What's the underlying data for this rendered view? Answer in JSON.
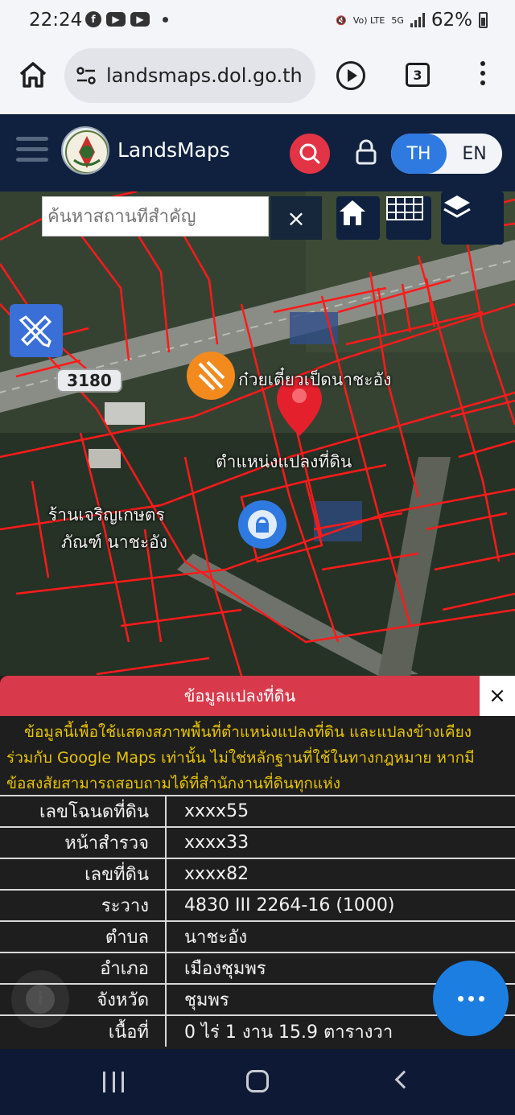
{
  "status_bar": {
    "time": "22:24",
    "app_icons": [
      "facebook-icon",
      "youtube-icon",
      "youtube-icon"
    ],
    "network": "5G",
    "volte": "Vo) LTE",
    "battery": "62%"
  },
  "browser": {
    "url": "landsmaps.dol.go.th",
    "tab_count": "3"
  },
  "app": {
    "title": "LandsMaps",
    "lang_th": "TH",
    "lang_en": "EN",
    "active_lang": "TH"
  },
  "map": {
    "search_placeholder": "ค้นหาสถานที่สำคัญ",
    "clear_label": "×",
    "road_number": "3180",
    "labels": {
      "poi_top": "ก๋วยเตี๋ยวเป็ดนาชะอัง",
      "parcel_position": "ตำแหน่งแปลงที่ดิน",
      "shop_line1": "ร้านเจริญเกษตร",
      "shop_line2": "ภัณฑ์ นาชะอัง"
    }
  },
  "panel": {
    "title": "ข้อมูลแปลงที่ดิน",
    "close_label": "×",
    "note_lines": [
      "ข้อมูลนี้เพื่อใช้แสดงสภาพพื้นที่ตำแหน่งแปลงที่ดิน และแปลงข้างเคียง",
      "ร่วมกับ Google Maps เท่านั้น ไม่ใช่หลักฐานที่ใช้ในทางกฎหมาย หากมี",
      "ข้อสงสัยสามารถสอบถามได้ที่สำนักงานที่ดินทุกแห่ง"
    ],
    "rows": [
      {
        "label": "เลขโฉนดที่ดิน",
        "value": "xxxx55"
      },
      {
        "label": "หน้าสำรวจ",
        "value": "xxxx33"
      },
      {
        "label": "เลขที่ดิน",
        "value": "xxxx82"
      },
      {
        "label": "ระวาง",
        "value": "4830 III 2264-16 (1000)"
      },
      {
        "label": "ตำบล",
        "value": "นาชะอัง"
      },
      {
        "label": "อำเภอ",
        "value": "เมืองชุมพร"
      },
      {
        "label": "จังหวัด",
        "value": "ชุมพร"
      },
      {
        "label": "เนื้อที่",
        "value": "0 ไร่ 1 งาน 15.9 ตารางวา"
      }
    ]
  },
  "colors": {
    "header_bg": "#0f213f",
    "accent_red": "#d8394b",
    "lang_active": "#2e7ae0",
    "parcel_lines": "#ff1a1a",
    "note_text": "#e7c400"
  }
}
